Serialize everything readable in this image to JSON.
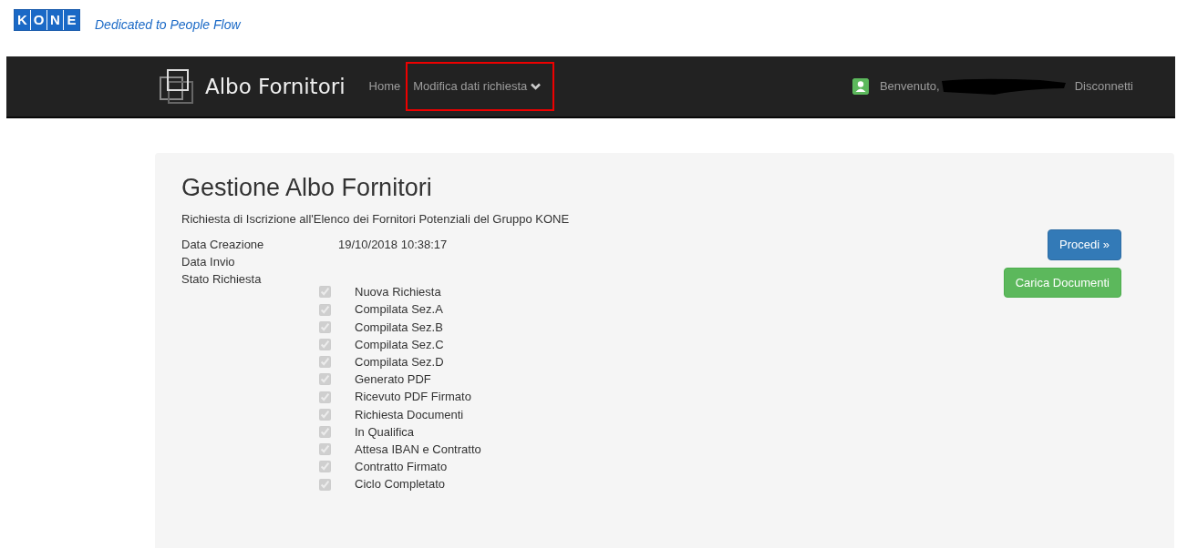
{
  "header": {
    "logo_letters": [
      "K",
      "O",
      "N",
      "E"
    ],
    "tagline": "Dedicated to People Flow"
  },
  "navbar": {
    "brand": "Albo Fornitori",
    "items": [
      {
        "label": "Home",
        "kind": "link",
        "highlighted": false
      },
      {
        "label": "Modifica dati richiesta",
        "kind": "dropdown",
        "highlighted": true
      }
    ],
    "welcome": "Benvenuto,",
    "user_redacted": true,
    "logout": "Disconnetti"
  },
  "panel": {
    "title": "Gestione Albo Fornitori",
    "subtitle": "Richiesta di Iscrizione all'Elenco dei Fornitori Potenziali del Gruppo KONE",
    "fields": [
      {
        "label": "Data Creazione",
        "value": "19/10/2018 10:38:17"
      },
      {
        "label": "Data Invio"
      },
      {
        "label": "Stato Richiesta"
      }
    ],
    "statuses": [
      {
        "label": "Nuova Richiesta",
        "checked": true,
        "disabled": true
      },
      {
        "label": "Compilata Sez.A",
        "checked": true,
        "disabled": true
      },
      {
        "label": "Compilata Sez.B",
        "checked": true,
        "disabled": true
      },
      {
        "label": "Compilata Sez.C",
        "checked": true,
        "disabled": true
      },
      {
        "label": "Compilata Sez.D",
        "checked": true,
        "disabled": true
      },
      {
        "label": "Generato PDF",
        "checked": true,
        "disabled": true
      },
      {
        "label": "Ricevuto PDF Firmato",
        "checked": true,
        "disabled": true
      },
      {
        "label": "Richiesta Documenti",
        "checked": true,
        "disabled": true
      },
      {
        "label": "In Qualifica",
        "checked": true,
        "disabled": true
      },
      {
        "label": "Attesa IBAN e Contratto",
        "checked": true,
        "disabled": true
      },
      {
        "label": "Contratto Firmato",
        "checked": true,
        "disabled": true
      },
      {
        "label": "Ciclo Completato",
        "checked": true,
        "disabled": true
      }
    ],
    "buttons": [
      {
        "label": "Procedi »",
        "kind": "primary"
      },
      {
        "label": "Carica Documenti",
        "kind": "success"
      }
    ]
  }
}
